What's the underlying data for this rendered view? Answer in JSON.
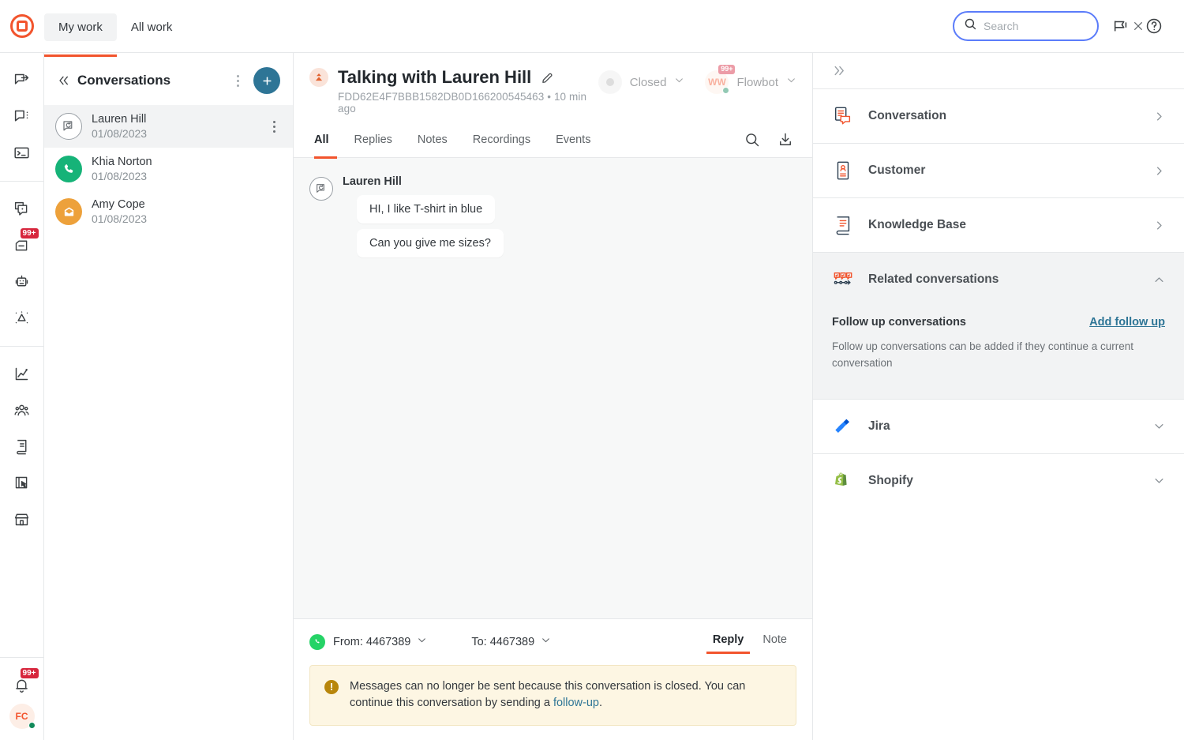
{
  "brand": {
    "logo_name": "intercom-style-logo",
    "accent": "#f2542d",
    "link": "#2e7596"
  },
  "topbar": {
    "tabs": [
      {
        "label": "My work",
        "active": true
      },
      {
        "label": "All work",
        "active": false
      }
    ],
    "search": {
      "value": "",
      "placeholder": "Search",
      "focused": true
    },
    "announce_icon": "megaphone-icon",
    "help_icon": "help-circle-icon"
  },
  "rail": {
    "items": [
      {
        "name": "outbound-message-icon",
        "badge": null
      },
      {
        "name": "chat-options-icon",
        "badge": null
      },
      {
        "name": "terminal-icon",
        "badge": null
      },
      {
        "name": "conversations-icon",
        "badge": null
      },
      {
        "name": "inbox-icon",
        "badge": "99+"
      },
      {
        "name": "bot-icon",
        "badge": null
      },
      {
        "name": "flow-node-icon",
        "badge": null
      },
      {
        "name": "analytics-icon",
        "badge": null
      },
      {
        "name": "contacts-icon",
        "badge": null
      },
      {
        "name": "knowledge-book-icon",
        "badge": null
      },
      {
        "name": "reports-icon",
        "badge": null
      },
      {
        "name": "store-icon",
        "badge": null
      }
    ],
    "notifications": {
      "icon": "bell-icon",
      "badge": "99+"
    },
    "user": {
      "initials": "FC",
      "status": "online"
    }
  },
  "conversations_panel": {
    "title": "Conversations",
    "collapse_icon": "chevron-double-left-icon",
    "menu_icon": "kebab-menu-icon",
    "add_icon": "plus-icon",
    "items": [
      {
        "name": "Lauren Hill",
        "date": "01/08/2023",
        "avatar": "followup-chat-icon",
        "avatar_style": "outline",
        "selected": true
      },
      {
        "name": "Khia Norton",
        "date": "01/08/2023",
        "avatar": "phone-icon",
        "avatar_style": "green",
        "selected": false
      },
      {
        "name": "Amy Cope",
        "date": "01/08/2023",
        "avatar": "email-icon",
        "avatar_style": "orange",
        "selected": false
      }
    ]
  },
  "conversation": {
    "priority_icon": "priority-escalated-icon",
    "title": "Talking with Lauren Hill",
    "edit_icon": "pencil-icon",
    "id": "FDD62E4F7BBB1582DB0D166200545463",
    "separator": "•",
    "time": "10 min ago",
    "status": {
      "label": "Closed",
      "chevron": "chevron-down-icon"
    },
    "assignee": {
      "initials": "WW",
      "name": "Flowbot",
      "badge": "99+",
      "chevron": "chevron-down-icon",
      "status": "online"
    },
    "tabs": [
      {
        "label": "All",
        "active": true
      },
      {
        "label": "Replies",
        "active": false
      },
      {
        "label": "Notes",
        "active": false
      },
      {
        "label": "Recordings",
        "active": false
      },
      {
        "label": "Events",
        "active": false
      }
    ],
    "tab_actions": [
      {
        "name": "search-icon"
      },
      {
        "name": "download-icon"
      }
    ],
    "messages": [
      {
        "sender": "Lauren Hill",
        "avatar": "followup-chat-icon",
        "bubbles": [
          "HI, I like T-shirt in blue",
          "Can you give me sizes?"
        ]
      }
    ]
  },
  "composer": {
    "channel_icon": "whatsapp-icon",
    "from_label": "From: 4467389",
    "to_label": "To: 4467389",
    "chevron": "chevron-down-icon",
    "tabs": [
      {
        "label": "Reply",
        "active": true
      },
      {
        "label": "Note",
        "active": false
      }
    ],
    "warning": {
      "icon": "exclamation-icon",
      "text_before": "Messages can no longer be sent because this conversation is closed. You can continue this conversation by sending a ",
      "link_text": "follow-up",
      "text_after": "."
    }
  },
  "right_panel": {
    "collapse_icon": "chevron-double-right-icon",
    "sections": [
      {
        "label": "Conversation",
        "icon": "conversation-details-icon",
        "state": "collapsed",
        "chevron": "chevron-right-icon"
      },
      {
        "label": "Customer",
        "icon": "customer-card-icon",
        "state": "collapsed",
        "chevron": "chevron-right-icon"
      },
      {
        "label": "Knowledge Base",
        "icon": "knowledge-book-icon",
        "state": "collapsed",
        "chevron": "chevron-right-icon"
      },
      {
        "label": "Related conversations",
        "icon": "related-conversations-icon",
        "state": "expanded",
        "chevron": "chevron-up-icon"
      },
      {
        "label": "Jira",
        "icon": "jira-logo-icon",
        "state": "collapsed",
        "chevron": "chevron-down-icon"
      },
      {
        "label": "Shopify",
        "icon": "shopify-logo-icon",
        "state": "collapsed",
        "chevron": "chevron-down-icon"
      }
    ],
    "related": {
      "title": "Follow up conversations",
      "action_label": "Add follow up",
      "description": "Follow up conversations can be added if they continue a current conversation"
    }
  }
}
